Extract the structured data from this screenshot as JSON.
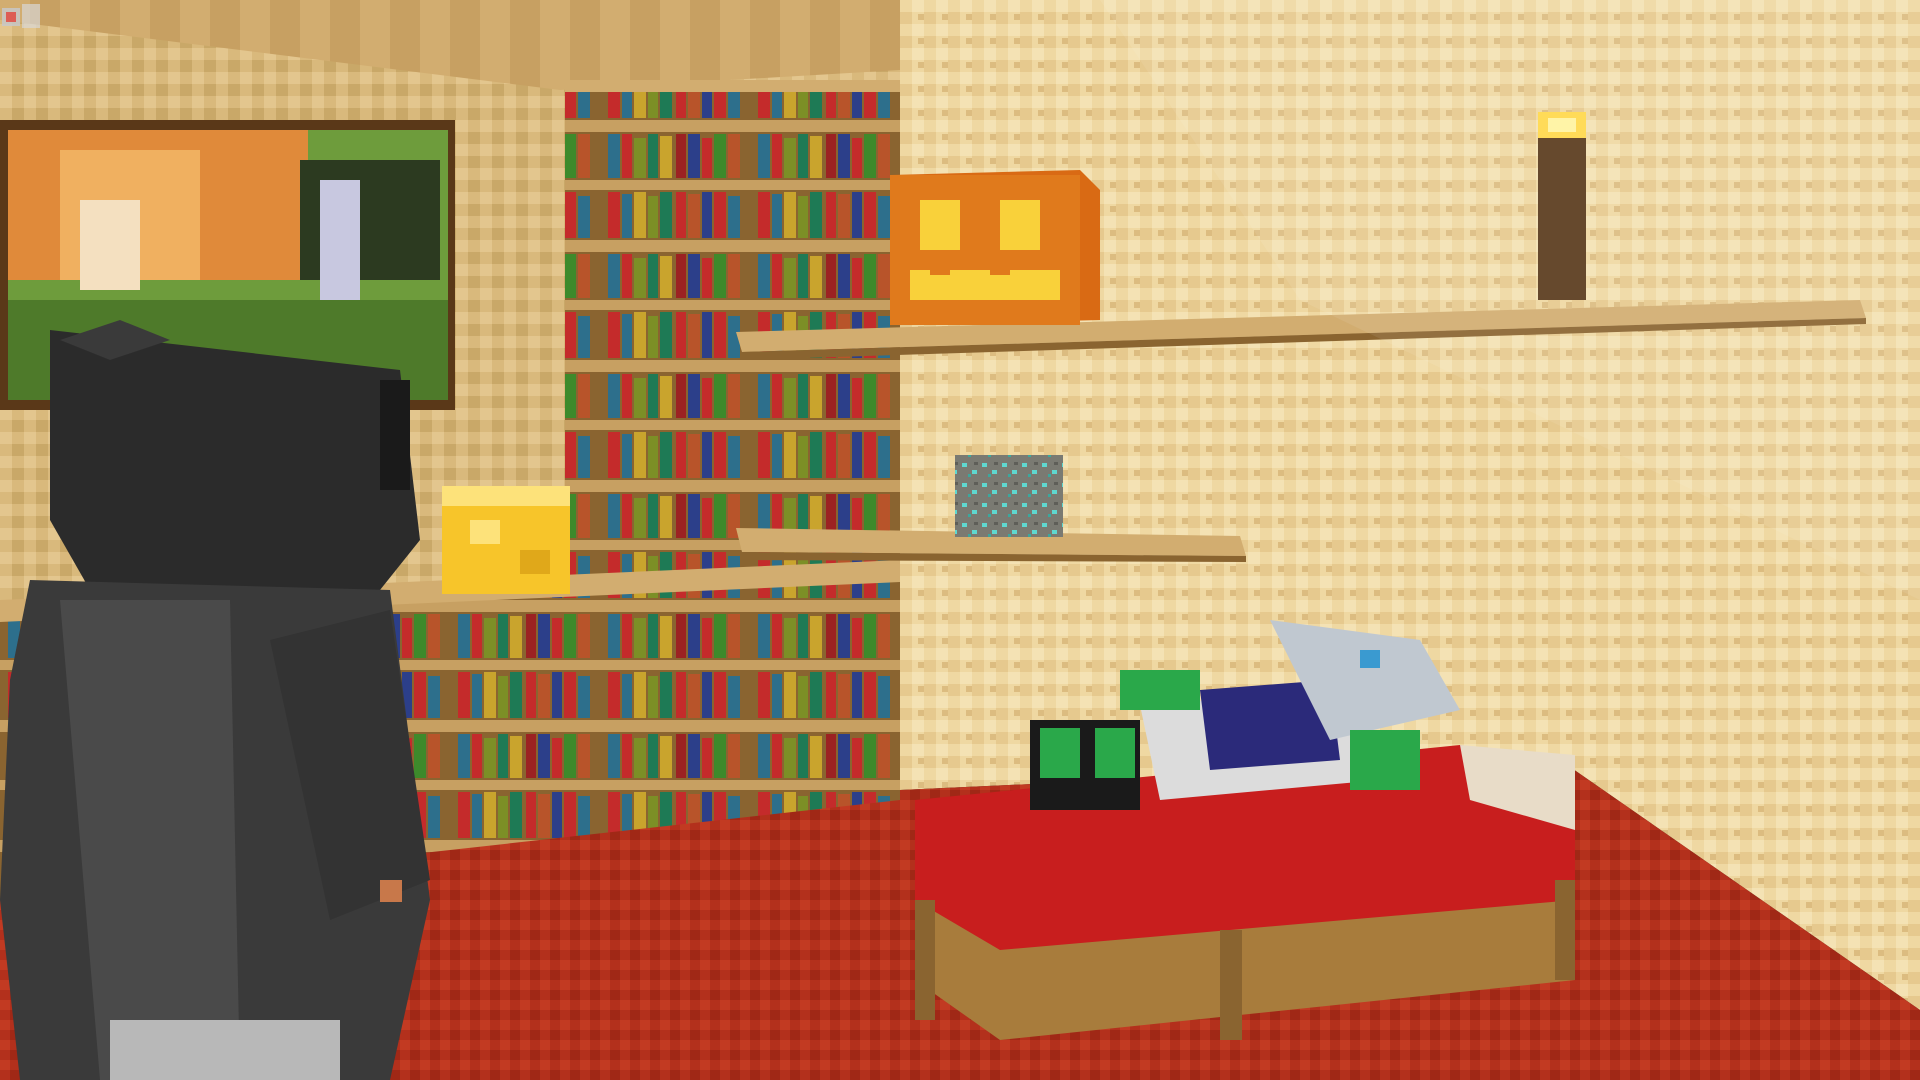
{
  "scene": {
    "description_visible_text": "",
    "objects": [
      {
        "name": "painting",
        "kind": "wall-painting"
      },
      {
        "name": "bookshelves",
        "kind": "bookshelf-wall"
      },
      {
        "name": "jack-o-lantern",
        "kind": "block"
      },
      {
        "name": "torch",
        "kind": "light"
      },
      {
        "name": "diamond-ore",
        "kind": "block"
      },
      {
        "name": "glowstone",
        "kind": "block"
      },
      {
        "name": "bed",
        "kind": "furniture"
      },
      {
        "name": "sleeping-player",
        "kind": "character"
      },
      {
        "name": "hooded-player",
        "kind": "character"
      }
    ]
  },
  "colors": {
    "wall_light": "#f0d9a4",
    "wall_shade": "#d6b67a",
    "carpet": "#b8321e",
    "carpet_dark": "#8e2414",
    "wood": "#c7a062",
    "wood_dark": "#8a6430",
    "pumpkin": "#e07a1c",
    "bed_red": "#c81e1e",
    "hood": "#2b2b2b",
    "diamond": "#5fd8d0"
  }
}
